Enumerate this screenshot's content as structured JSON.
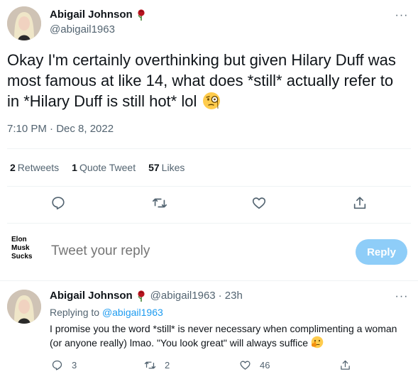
{
  "main_tweet": {
    "author_name": "Abigail Johnson",
    "author_handle": "@abigail1963",
    "text": "Okay I'm certainly overthinking but given Hilary Duff was most famous at like 14, what does *still* actually refer to in *Hilary Duff is still hot* lol",
    "emoji": "face-with-monocle",
    "timestamp": "7:10 PM · Dec 8, 2022",
    "stats": {
      "retweets_count": "2",
      "retweets_label": "Retweets",
      "quotes_count": "1",
      "quotes_label": "Quote Tweet",
      "likes_count": "57",
      "likes_label": "Likes"
    },
    "actions": [
      "reply-icon",
      "retweet-icon",
      "like-icon",
      "share-icon"
    ]
  },
  "reply_composer": {
    "avatar_lines": [
      "Elon",
      "Musk",
      "Sucks"
    ],
    "placeholder": "Tweet your reply",
    "button_label": "Reply"
  },
  "reply_tweet": {
    "author_name": "Abigail Johnson",
    "author_handle": "@abigail1963",
    "time": "· 23h",
    "replying_prefix": "Replying to",
    "replying_to": "@abigail1963",
    "text": "I promise you the word *still* is never necessary when complimenting a woman (or anyone really) lmao. \"You look great\" will always suffice",
    "emoji": "shushing-face",
    "reply_count": "3",
    "retweet_count": "2",
    "like_count": "46"
  },
  "colors": {
    "accent": "#1d9bf0",
    "reply_button": "#8ecdf8",
    "secondary_text": "#536471",
    "divider": "#eff3f4",
    "rose": "#b8141f"
  }
}
